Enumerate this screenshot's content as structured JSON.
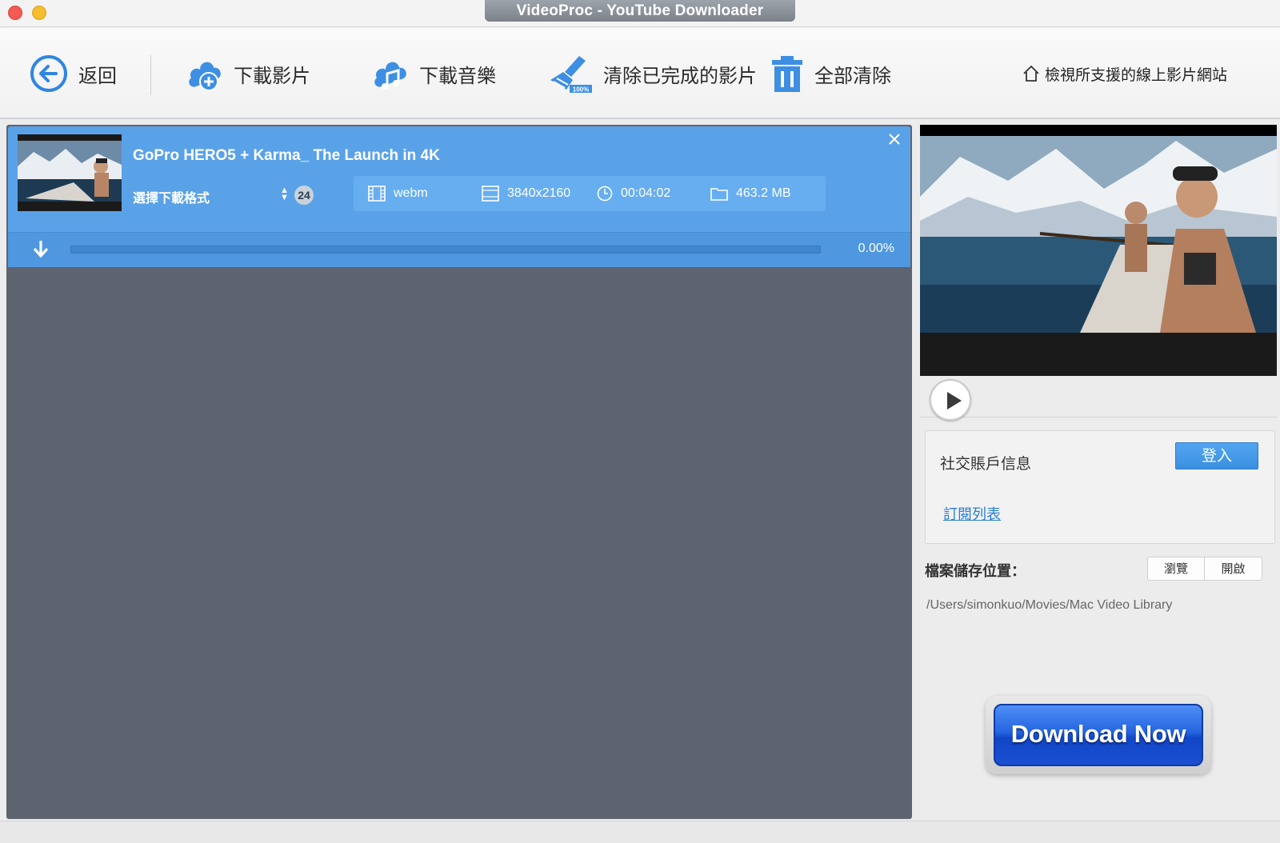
{
  "window": {
    "title": "VideoProc - YouTube Downloader"
  },
  "toolbar": {
    "back_label": "返回",
    "download_video_label": "下載影片",
    "download_music_label": "下載音樂",
    "clear_completed_label": "清除已完成的影片",
    "clear_all_label": "全部清除",
    "supported_sites_label": "檢視所支援的線上影片網站"
  },
  "download_item": {
    "title": "GoPro HERO5 + Karma_ The Launch in 4K",
    "format_label": "選擇下載格式",
    "format_count": "24",
    "container": "webm",
    "resolution": "3840x2160",
    "duration": "00:04:02",
    "size": "463.2 MB",
    "progress_text": "0.00%",
    "progress_fraction": 0.0
  },
  "account": {
    "social_label": "社交賬戶信息",
    "login_label": "登入",
    "subscription_link": "訂閱列表"
  },
  "save": {
    "label": "檔案儲存位置：",
    "browse_label": "瀏覽",
    "open_label": "開啟",
    "path": "/Users/simonkuo/Movies/Mac Video Library"
  },
  "promo": {
    "download_now_label": "Download Now"
  },
  "colors": {
    "accent_blue": "#5aa2e8",
    "left_bg": "#5e6370",
    "button_blue": "#2565e0"
  }
}
